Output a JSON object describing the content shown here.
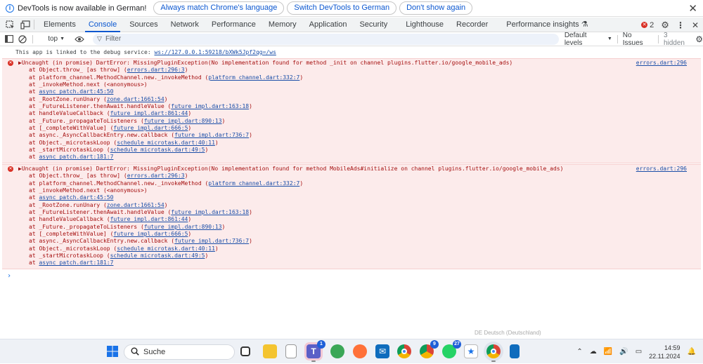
{
  "infobar": {
    "message": "DevTools is now available in German!",
    "btn_match": "Always match Chrome's language",
    "btn_switch": "Switch DevTools to German",
    "btn_dismiss": "Don't show again"
  },
  "tabs": [
    "Elements",
    "Console",
    "Sources",
    "Network",
    "Performance",
    "Memory",
    "Application",
    "Security",
    "Lighthouse",
    "Recorder",
    "Performance insights"
  ],
  "tabs_active": "Console",
  "error_count": "2",
  "toolbar": {
    "context": "top",
    "filter_placeholder": "Filter",
    "levels": "Default levels",
    "issues": "No Issues",
    "hidden": "3 hidden"
  },
  "console": {
    "link_prefix": "This app is linked to the debug service: ",
    "link_url": "ws://127.0.0.1:59218/bXWk5Jpf2qg=/ws",
    "errors": [
      {
        "head": "▶Uncaught (in promise) DartError: MissingPluginException(No implementation found for method _init on channel plugins.flutter.io/google_mobile_ads)",
        "source": "errors.dart:296",
        "frames": [
          {
            "pre": "at Object.throw_ [as throw] (",
            "link": "errors.dart:296:3",
            "post": ")"
          },
          {
            "pre": "at platform_channel.MethodChannel.new._invokeMethod (",
            "link": "platform_channel.dart:332:7",
            "post": ")"
          },
          {
            "pre": "at _invokeMethod.next (<anonymous>)",
            "link": "",
            "post": ""
          },
          {
            "pre": "at ",
            "link": "async_patch.dart:45:50",
            "post": ""
          },
          {
            "pre": "at _RootZone.runUnary (",
            "link": "zone.dart:1661:54",
            "post": ")"
          },
          {
            "pre": "at _FutureListener.thenAwait.handleValue (",
            "link": "future_impl.dart:163:18",
            "post": ")"
          },
          {
            "pre": "at handleValueCallback (",
            "link": "future_impl.dart:861:44",
            "post": ")"
          },
          {
            "pre": "at _Future._propagateToListeners (",
            "link": "future_impl.dart:890:13",
            "post": ")"
          },
          {
            "pre": "at [_completeWithValue] (",
            "link": "future_impl.dart:666:5",
            "post": ")"
          },
          {
            "pre": "at async._AsyncCallbackEntry.new.callback (",
            "link": "future_impl.dart:736:7",
            "post": ")"
          },
          {
            "pre": "at Object._microtaskLoop (",
            "link": "schedule_microtask.dart:40:11",
            "post": ")"
          },
          {
            "pre": "at _startMicrotaskLoop (",
            "link": "schedule_microtask.dart:49:5",
            "post": ")"
          },
          {
            "pre": "at ",
            "link": "async_patch.dart:181:7",
            "post": ""
          }
        ]
      },
      {
        "head": "▶Uncaught (in promise) DartError: MissingPluginException(No implementation found for method MobileAds#initialize on channel plugins.flutter.io/google_mobile_ads)",
        "source": "errors.dart:296",
        "frames": [
          {
            "pre": "at Object.throw_ [as throw] (",
            "link": "errors.dart:296:3",
            "post": ")"
          },
          {
            "pre": "at platform_channel.MethodChannel.new._invokeMethod (",
            "link": "platform_channel.dart:332:7",
            "post": ")"
          },
          {
            "pre": "at _invokeMethod.next (<anonymous>)",
            "link": "",
            "post": ""
          },
          {
            "pre": "at ",
            "link": "async_patch.dart:45:50",
            "post": ""
          },
          {
            "pre": "at _RootZone.runUnary (",
            "link": "zone.dart:1661:54",
            "post": ")"
          },
          {
            "pre": "at _FutureListener.thenAwait.handleValue (",
            "link": "future_impl.dart:163:18",
            "post": ")"
          },
          {
            "pre": "at handleValueCallback (",
            "link": "future_impl.dart:861:44",
            "post": ")"
          },
          {
            "pre": "at _Future._propagateToListeners (",
            "link": "future_impl.dart:890:13",
            "post": ")"
          },
          {
            "pre": "at [_completeWithValue] (",
            "link": "future_impl.dart:666:5",
            "post": ")"
          },
          {
            "pre": "at async._AsyncCallbackEntry.new.callback (",
            "link": "future_impl.dart:736:7",
            "post": ")"
          },
          {
            "pre": "at Object._microtaskLoop (",
            "link": "schedule_microtask.dart:40:11",
            "post": ")"
          },
          {
            "pre": "at _startMicrotaskLoop (",
            "link": "schedule_microtask.dart:49:5",
            "post": ")"
          },
          {
            "pre": "at ",
            "link": "async_patch.dart:181:7",
            "post": ""
          }
        ]
      }
    ],
    "prompt": "›"
  },
  "lang_hint": "DE Deutsch (Deutschland)",
  "taskbar": {
    "search_label": "Suche",
    "teams_badge": "1",
    "chrome2_badge": "9",
    "whatsapp_badge": "27",
    "time": "14:59",
    "date": "22.11.2024"
  },
  "colors": {
    "accent": "#0b57d0",
    "error_bg": "#fcebeb",
    "error_text": "#a50e0e",
    "error_icon": "#d93025"
  }
}
